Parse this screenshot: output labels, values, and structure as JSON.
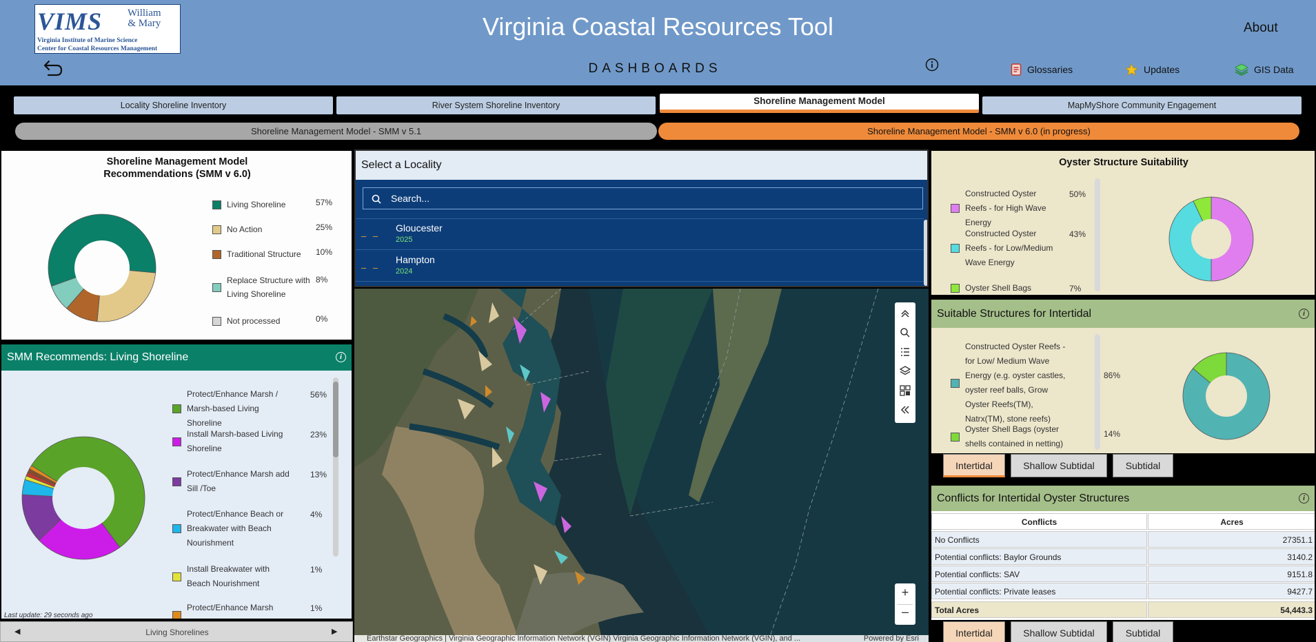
{
  "header": {
    "logo": {
      "vims": "VIMS",
      "wm_line1": "William",
      "wm_line2": "& Mary",
      "line1": "Virginia Institute of Marine Science",
      "line2": "Center for Coastal Resources Management"
    },
    "title": "Virginia Coastal Resources Tool",
    "about": "About",
    "dashboards": "DASHBOARDS",
    "links": [
      {
        "label": "Glossaries",
        "icon": "glossary-icon"
      },
      {
        "label": "Updates",
        "icon": "star-icon"
      },
      {
        "label": "GIS Data",
        "icon": "layers-icon"
      }
    ]
  },
  "tabs": [
    "Locality Shoreline Inventory",
    "River System Shoreline Inventory",
    "Shoreline Management Model",
    "MapMyShore Community Engagement"
  ],
  "subtabs": [
    "Shoreline Management Model - SMM v 5.1",
    "Shoreline Management Model - SMM v 6.0 (in progress)"
  ],
  "colors": {
    "header": "#7099c9",
    "accent": "#ef8a3a",
    "green_header": "#0b8068",
    "sage": "#a5bf8a",
    "list_blue": "#0c3d78"
  },
  "smm": {
    "title_l1": "Shoreline Management Model",
    "title_l2": "Recommendations (SMM v 6.0)",
    "items": [
      {
        "label": "Living Shoreline",
        "pct": "57%",
        "value": 57,
        "color": "#0b8068"
      },
      {
        "label": "No Action",
        "pct": "25%",
        "value": 25,
        "color": "#e2c98a"
      },
      {
        "label": "Traditional Structure",
        "pct": "10%",
        "value": 10,
        "color": "#b0652a"
      },
      {
        "label": "Replace Structure with Living Shoreline",
        "pct": "8%",
        "value": 8,
        "color": "#82cdbd"
      },
      {
        "label": "Not processed",
        "pct": "0%",
        "value": 0,
        "color": "#d6d6d6"
      }
    ]
  },
  "living": {
    "title": "SMM Recommends: Living Shoreline",
    "items": [
      {
        "label": "Protect/Enhance Marsh / Marsh-based Living Shoreline",
        "pct": "56%",
        "value": 56,
        "color": "#5aa329"
      },
      {
        "label": "Install Marsh-based Living Shoreline",
        "pct": "23%",
        "value": 23,
        "color": "#cc1ce8"
      },
      {
        "label": "Protect/Enhance Marsh add Sill /Toe",
        "pct": "13%",
        "value": 13,
        "color": "#7b3b9f"
      },
      {
        "label": "Protect/Enhance Beach or Breakwater with Beach Nourishment",
        "pct": "4%",
        "value": 4,
        "color": "#1fb6ea"
      },
      {
        "label": "Install Breakwater with Beach Nourishment",
        "pct": "1%",
        "value": 1,
        "color": "#e1e23a"
      },
      {
        "label": "Protect/Enhance Marsh with",
        "pct": "1%",
        "value": 1,
        "color": "#e08a1e"
      }
    ],
    "pie_extra": [
      {
        "value": 1,
        "color": "#c0392b"
      },
      {
        "value": 1,
        "color": "#8b4a2b"
      }
    ],
    "last_update": "Last update: 29 seconds ago",
    "footer": "Living Shorelines"
  },
  "locality": {
    "title": "Select a Locality",
    "search_placeholder": "Search...",
    "items": [
      {
        "name": "Gloucester",
        "year": "2025"
      },
      {
        "name": "Hampton",
        "year": "2024"
      }
    ]
  },
  "map": {
    "attribution": "Earthstar Geographics | Virginia Geographic Information Network (VGIN) Virginia Geographic Information Network (VGIN), and ...",
    "powered": "Powered by Esri",
    "tools": [
      "chevrons-up-icon",
      "search-icon",
      "list-icon",
      "layers-icon",
      "qr-icon",
      "collapse-icon"
    ]
  },
  "oyster": {
    "title": "Oyster Structure Suitability",
    "items": [
      {
        "label": "Constructed Oyster Reefs - for High Wave Energy",
        "pct": "50%",
        "value": 50,
        "color": "#e07ef0"
      },
      {
        "label": "Constructed Oyster Reefs - for Low/Medium Wave Energy",
        "pct": "43%",
        "value": 43,
        "color": "#55dbe0"
      },
      {
        "label": "Oyster Shell Bags",
        "pct": "7%",
        "value": 7,
        "color": "#8ee83a"
      }
    ]
  },
  "intertidal": {
    "title": "Suitable Structures for Intertidal",
    "items": [
      {
        "label": "Constructed Oyster Reefs - for Low/ Medium Wave Energy (e.g. oyster castles, oyster reef balls, Grow Oyster Reefs(TM), Natrx(TM), stone reefs)",
        "pct": "86%",
        "value": 86,
        "color": "#52b3b3"
      },
      {
        "label": "Oyster Shell Bags (oyster shells contained in netting)",
        "pct": "14%",
        "value": 14,
        "color": "#7ed93a"
      }
    ],
    "tabs": [
      "Intertidal",
      "Shallow Subtidal",
      "Subtidal"
    ]
  },
  "conflicts": {
    "title": "Conflicts for Intertidal Oyster Structures",
    "headers": [
      "Conflicts",
      "Acres"
    ],
    "rows": [
      {
        "label": "No Conflicts",
        "value": "27351.1"
      },
      {
        "label": "Potential conflicts: Baylor Grounds",
        "value": "3140.2"
      },
      {
        "label": "Potential conflicts: SAV",
        "value": "9151.8"
      },
      {
        "label": "Potential conflicts: Private leases",
        "value": "9427.7"
      }
    ],
    "total_label": "Total Acres",
    "total_value": "54,443.3",
    "tabs": [
      "Intertidal",
      "Shallow Subtidal",
      "Subtidal"
    ]
  }
}
